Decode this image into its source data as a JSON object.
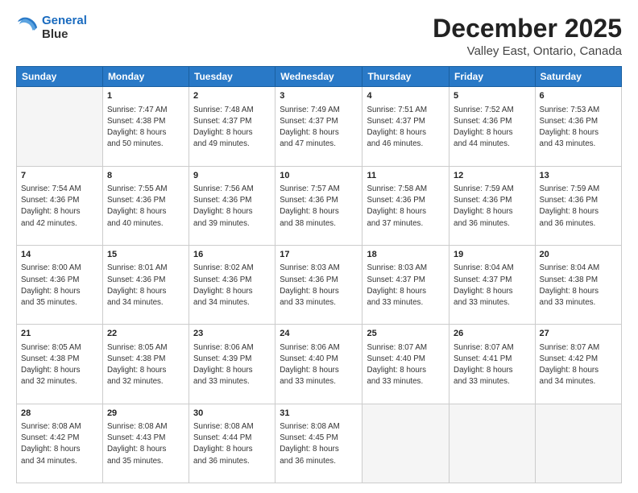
{
  "header": {
    "logo_line1": "General",
    "logo_line2": "Blue",
    "title": "December 2025",
    "subtitle": "Valley East, Ontario, Canada"
  },
  "days_of_week": [
    "Sunday",
    "Monday",
    "Tuesday",
    "Wednesday",
    "Thursday",
    "Friday",
    "Saturday"
  ],
  "weeks": [
    [
      {
        "num": "",
        "info": ""
      },
      {
        "num": "1",
        "info": "Sunrise: 7:47 AM\nSunset: 4:38 PM\nDaylight: 8 hours\nand 50 minutes."
      },
      {
        "num": "2",
        "info": "Sunrise: 7:48 AM\nSunset: 4:37 PM\nDaylight: 8 hours\nand 49 minutes."
      },
      {
        "num": "3",
        "info": "Sunrise: 7:49 AM\nSunset: 4:37 PM\nDaylight: 8 hours\nand 47 minutes."
      },
      {
        "num": "4",
        "info": "Sunrise: 7:51 AM\nSunset: 4:37 PM\nDaylight: 8 hours\nand 46 minutes."
      },
      {
        "num": "5",
        "info": "Sunrise: 7:52 AM\nSunset: 4:36 PM\nDaylight: 8 hours\nand 44 minutes."
      },
      {
        "num": "6",
        "info": "Sunrise: 7:53 AM\nSunset: 4:36 PM\nDaylight: 8 hours\nand 43 minutes."
      }
    ],
    [
      {
        "num": "7",
        "info": "Sunrise: 7:54 AM\nSunset: 4:36 PM\nDaylight: 8 hours\nand 42 minutes."
      },
      {
        "num": "8",
        "info": "Sunrise: 7:55 AM\nSunset: 4:36 PM\nDaylight: 8 hours\nand 40 minutes."
      },
      {
        "num": "9",
        "info": "Sunrise: 7:56 AM\nSunset: 4:36 PM\nDaylight: 8 hours\nand 39 minutes."
      },
      {
        "num": "10",
        "info": "Sunrise: 7:57 AM\nSunset: 4:36 PM\nDaylight: 8 hours\nand 38 minutes."
      },
      {
        "num": "11",
        "info": "Sunrise: 7:58 AM\nSunset: 4:36 PM\nDaylight: 8 hours\nand 37 minutes."
      },
      {
        "num": "12",
        "info": "Sunrise: 7:59 AM\nSunset: 4:36 PM\nDaylight: 8 hours\nand 36 minutes."
      },
      {
        "num": "13",
        "info": "Sunrise: 7:59 AM\nSunset: 4:36 PM\nDaylight: 8 hours\nand 36 minutes."
      }
    ],
    [
      {
        "num": "14",
        "info": "Sunrise: 8:00 AM\nSunset: 4:36 PM\nDaylight: 8 hours\nand 35 minutes."
      },
      {
        "num": "15",
        "info": "Sunrise: 8:01 AM\nSunset: 4:36 PM\nDaylight: 8 hours\nand 34 minutes."
      },
      {
        "num": "16",
        "info": "Sunrise: 8:02 AM\nSunset: 4:36 PM\nDaylight: 8 hours\nand 34 minutes."
      },
      {
        "num": "17",
        "info": "Sunrise: 8:03 AM\nSunset: 4:36 PM\nDaylight: 8 hours\nand 33 minutes."
      },
      {
        "num": "18",
        "info": "Sunrise: 8:03 AM\nSunset: 4:37 PM\nDaylight: 8 hours\nand 33 minutes."
      },
      {
        "num": "19",
        "info": "Sunrise: 8:04 AM\nSunset: 4:37 PM\nDaylight: 8 hours\nand 33 minutes."
      },
      {
        "num": "20",
        "info": "Sunrise: 8:04 AM\nSunset: 4:38 PM\nDaylight: 8 hours\nand 33 minutes."
      }
    ],
    [
      {
        "num": "21",
        "info": "Sunrise: 8:05 AM\nSunset: 4:38 PM\nDaylight: 8 hours\nand 32 minutes."
      },
      {
        "num": "22",
        "info": "Sunrise: 8:05 AM\nSunset: 4:38 PM\nDaylight: 8 hours\nand 32 minutes."
      },
      {
        "num": "23",
        "info": "Sunrise: 8:06 AM\nSunset: 4:39 PM\nDaylight: 8 hours\nand 33 minutes."
      },
      {
        "num": "24",
        "info": "Sunrise: 8:06 AM\nSunset: 4:40 PM\nDaylight: 8 hours\nand 33 minutes."
      },
      {
        "num": "25",
        "info": "Sunrise: 8:07 AM\nSunset: 4:40 PM\nDaylight: 8 hours\nand 33 minutes."
      },
      {
        "num": "26",
        "info": "Sunrise: 8:07 AM\nSunset: 4:41 PM\nDaylight: 8 hours\nand 33 minutes."
      },
      {
        "num": "27",
        "info": "Sunrise: 8:07 AM\nSunset: 4:42 PM\nDaylight: 8 hours\nand 34 minutes."
      }
    ],
    [
      {
        "num": "28",
        "info": "Sunrise: 8:08 AM\nSunset: 4:42 PM\nDaylight: 8 hours\nand 34 minutes."
      },
      {
        "num": "29",
        "info": "Sunrise: 8:08 AM\nSunset: 4:43 PM\nDaylight: 8 hours\nand 35 minutes."
      },
      {
        "num": "30",
        "info": "Sunrise: 8:08 AM\nSunset: 4:44 PM\nDaylight: 8 hours\nand 36 minutes."
      },
      {
        "num": "31",
        "info": "Sunrise: 8:08 AM\nSunset: 4:45 PM\nDaylight: 8 hours\nand 36 minutes."
      },
      {
        "num": "",
        "info": ""
      },
      {
        "num": "",
        "info": ""
      },
      {
        "num": "",
        "info": ""
      }
    ]
  ]
}
